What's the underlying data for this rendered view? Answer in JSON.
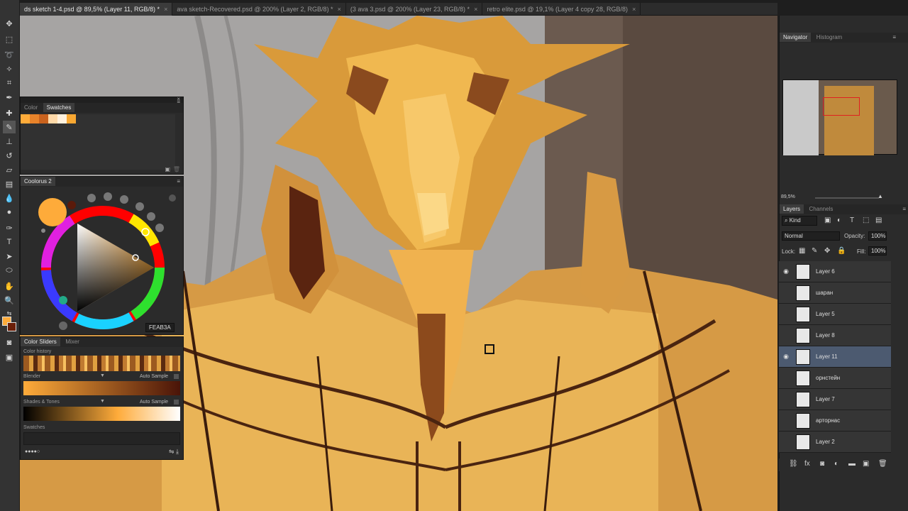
{
  "tabs": [
    {
      "label": "ds sketch 1-4.psd @ 89,5% (Layer 11, RGB/8) *",
      "active": true
    },
    {
      "label": "ava sketch-Recovered.psd @ 200% (Layer 2, RGB/8) *",
      "active": false
    },
    {
      "label": "(3 ava 3.psd @ 200% (Layer 23, RGB/8) *",
      "active": false
    },
    {
      "label": "retro elite.psd @ 19,1% (Layer 4 copy 28, RGB/8)",
      "active": false
    }
  ],
  "tab_close_glyph": "×",
  "swatches_panel": {
    "tabs": [
      "Color",
      "Swatches"
    ],
    "colors": [
      "#FEAB3A",
      "#E8832A",
      "#C9621D",
      "#FFD9A8",
      "#FFF1DD",
      "#F9A832"
    ]
  },
  "coolorus": {
    "title": "Coolorus 2",
    "hex": "FEAB3A",
    "current_color": "#FEAB3A"
  },
  "color_sliders_panel": {
    "tabs": [
      "Color Sliders",
      "Mixer"
    ],
    "history_label": "Color history",
    "blender_label": "Blender",
    "auto_sample_label": "Auto Sample",
    "shades_label": "Shades & Tones",
    "auto_sample_label_2": "Auto Sample",
    "swatches_label": "Swatches"
  },
  "navigator": {
    "tabs": [
      "Navigator",
      "Histogram"
    ],
    "zoom": "89,5%"
  },
  "layers": {
    "tabs": [
      "Layers",
      "Channels"
    ],
    "kind_label": "Kind",
    "blend_mode": "Normal",
    "opacity_label": "Opacity:",
    "opacity_value": "100%",
    "lock_label": "Lock:",
    "fill_label": "Fill:",
    "fill_value": "100%",
    "items": [
      {
        "name": "Layer 6",
        "visible": true,
        "active": false
      },
      {
        "name": "шаран",
        "visible": false,
        "active": false
      },
      {
        "name": "Layer 5",
        "visible": false,
        "active": false
      },
      {
        "name": "Layer 8",
        "visible": false,
        "active": false
      },
      {
        "name": "Layer 11",
        "visible": true,
        "active": true
      },
      {
        "name": "орнстейн",
        "visible": false,
        "active": false
      },
      {
        "name": "Layer 7",
        "visible": false,
        "active": false
      },
      {
        "name": "арторнас",
        "visible": false,
        "active": false
      },
      {
        "name": "Layer 2",
        "visible": false,
        "active": false
      }
    ]
  }
}
